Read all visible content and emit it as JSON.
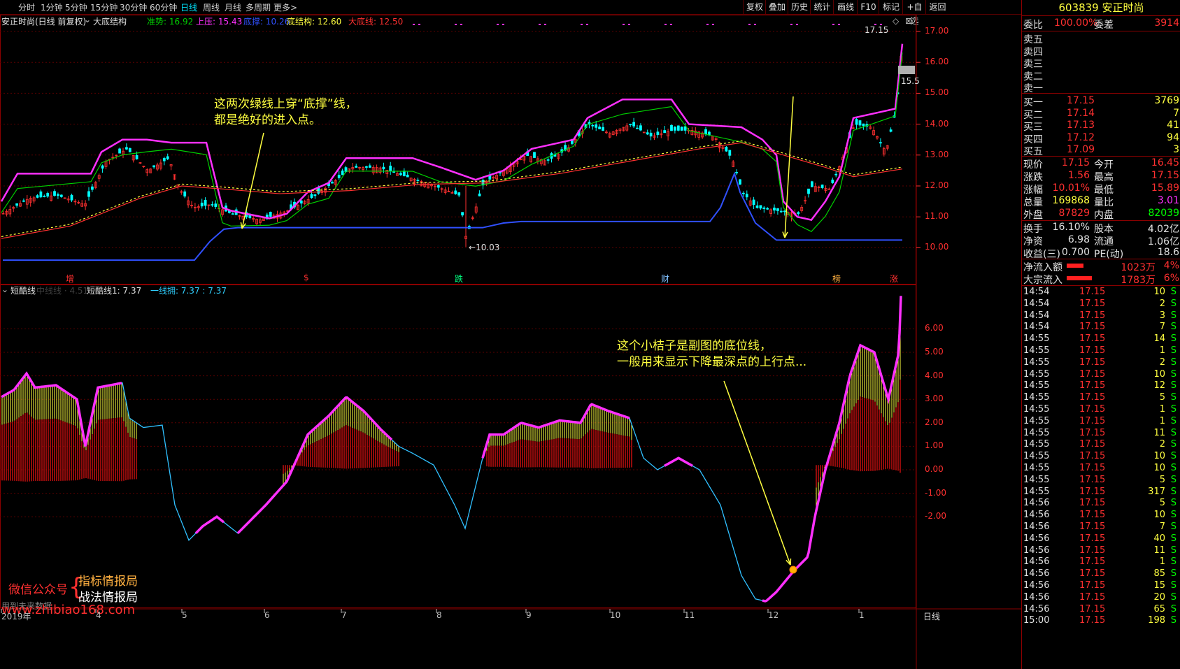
{
  "toolbar": {
    "periods": [
      "分时",
      "1分钟",
      "5分钟",
      "15分钟",
      "30分钟",
      "60分钟",
      "日线",
      "周线",
      "月线",
      "多周期",
      "更多>"
    ],
    "active_period": "日线",
    "buttons": [
      "复权",
      "叠加",
      "历史",
      "统计",
      "画线",
      "F10",
      "标记",
      "+自选",
      "返回"
    ]
  },
  "main_chart": {
    "title": "安正时尚(日线 前复权)",
    "indicator_name": "大底结构",
    "legend": [
      {
        "label": "准势: 16.92",
        "color": "#00d000"
      },
      {
        "label": "上压: 15.43",
        "color": "#ff30ff"
      },
      {
        "label": "底撑: 10.26",
        "color": "#3050ff"
      },
      {
        "label": "底结构: 12.60",
        "color": "#ffff40"
      },
      {
        "label": "大底线: 12.50",
        "color": "#ff3030"
      }
    ],
    "y_ticks": [
      "17.00",
      "16.00",
      "15.00",
      "14.00",
      "13.00",
      "12.00",
      "11.00",
      "10.00"
    ],
    "price_high_label": "17.15",
    "price_low_label": "10.03",
    "price_tag": "15.5",
    "markers": [
      {
        "text": "增",
        "color": "#ff3030"
      },
      {
        "text": "$",
        "color": "#ff3030"
      },
      {
        "text": "跌",
        "color": "#00ff80"
      },
      {
        "text": "财",
        "color": "#80c0ff"
      },
      {
        "text": "榜",
        "color": "#ffb040"
      },
      {
        "text": "涨",
        "color": "#ff3030"
      }
    ],
    "annotation": [
      "这两次绿线上穿“底撑”线，",
      "都是绝好的进入点。"
    ]
  },
  "sub_chart": {
    "title": "短酷线",
    "faded_label": "中线线 · 4.51",
    "legend1": "短酷线1: 7.37",
    "legend2": "一线拥: 7.37  : 7.37",
    "y_ticks": [
      "6.00",
      "5.00",
      "4.00",
      "3.00",
      "2.00",
      "1.00",
      "0.00",
      "-1.00",
      "-2.00"
    ],
    "annotation": [
      "这个小桔子是副图的底位线，",
      "一般用来显示下降最深点的上行点..."
    ]
  },
  "watermark": {
    "wechat_label": "微信公众号",
    "names": [
      "指标情报局",
      "战法情报局"
    ],
    "disclaimer": "用到未来数据",
    "url": "www.zhibiao168.com"
  },
  "x_axis": {
    "labels": [
      "2019年",
      "4",
      "5",
      "6",
      "7",
      "8",
      "9",
      "10",
      "11",
      "12",
      "1"
    ],
    "period_label": "日线"
  },
  "right_panel": {
    "stock_code": "603839",
    "stock_name": "安正时尚",
    "weibi_label": "委比",
    "weibi_value": "100.00%",
    "weicha_label": "委差",
    "weicha_value": "3914",
    "asks": [
      {
        "label": "卖五",
        "price": "",
        "vol": ""
      },
      {
        "label": "卖四",
        "price": "",
        "vol": ""
      },
      {
        "label": "卖三",
        "price": "",
        "vol": ""
      },
      {
        "label": "卖二",
        "price": "",
        "vol": ""
      },
      {
        "label": "卖一",
        "price": "",
        "vol": ""
      }
    ],
    "bids": [
      {
        "label": "买一",
        "price": "17.15",
        "vol": "3769"
      },
      {
        "label": "买二",
        "price": "17.14",
        "vol": "7"
      },
      {
        "label": "买三",
        "price": "17.13",
        "vol": "41"
      },
      {
        "label": "买四",
        "price": "17.12",
        "vol": "94"
      },
      {
        "label": "买五",
        "price": "17.09",
        "vol": "3"
      }
    ],
    "quote": [
      {
        "l1": "现价",
        "v1": "17.15",
        "l2": "今开",
        "v2": "16.45",
        "c1": "#ff3030",
        "c2": "#ff3030"
      },
      {
        "l1": "涨跌",
        "v1": "1.56",
        "l2": "最高",
        "v2": "17.15",
        "c1": "#ff3030",
        "c2": "#ff3030"
      },
      {
        "l1": "涨幅",
        "v1": "10.01%",
        "l2": "最低",
        "v2": "15.89",
        "c1": "#ff3030",
        "c2": "#ff3030"
      },
      {
        "l1": "总量",
        "v1": "169868",
        "l2": "量比",
        "v2": "3.01",
        "c1": "#ffff40",
        "c2": "#ff30ff"
      },
      {
        "l1": "外盘",
        "v1": "87829",
        "l2": "内盘",
        "v2": "82039",
        "c1": "#ff3030",
        "c2": "#00ff00"
      }
    ],
    "fundamentals": [
      {
        "l1": "换手",
        "v1": "16.10%",
        "l2": "股本",
        "v2": "4.02亿"
      },
      {
        "l1": "净资",
        "v1": "6.98",
        "l2": "流通",
        "v2": "1.06亿"
      },
      {
        "l1": "收益(三)",
        "v1": "0.700",
        "l2": "PE(动)",
        "v2": "18.6"
      }
    ],
    "flows": [
      {
        "label": "净流入额",
        "value": "1023万",
        "pct": "4%",
        "bar": 0.4
      },
      {
        "label": "大宗流入",
        "value": "1783万",
        "pct": "6%",
        "bar": 0.6
      }
    ],
    "ticks": [
      {
        "time": "14:54",
        "price": "17.15",
        "vol": "10",
        "side": "S"
      },
      {
        "time": "14:54",
        "price": "17.15",
        "vol": "2",
        "side": "S"
      },
      {
        "time": "14:54",
        "price": "17.15",
        "vol": "3",
        "side": "S"
      },
      {
        "time": "14:54",
        "price": "17.15",
        "vol": "7",
        "side": "S"
      },
      {
        "time": "14:55",
        "price": "17.15",
        "vol": "14",
        "side": "S"
      },
      {
        "time": "14:55",
        "price": "17.15",
        "vol": "1",
        "side": "S"
      },
      {
        "time": "14:55",
        "price": "17.15",
        "vol": "2",
        "side": "S"
      },
      {
        "time": "14:55",
        "price": "17.15",
        "vol": "10",
        "side": "S"
      },
      {
        "time": "14:55",
        "price": "17.15",
        "vol": "12",
        "side": "S"
      },
      {
        "time": "14:55",
        "price": "17.15",
        "vol": "5",
        "side": "S"
      },
      {
        "time": "14:55",
        "price": "17.15",
        "vol": "1",
        "side": "S"
      },
      {
        "time": "14:55",
        "price": "17.15",
        "vol": "1",
        "side": "S"
      },
      {
        "time": "14:55",
        "price": "17.15",
        "vol": "11",
        "side": "S"
      },
      {
        "time": "14:55",
        "price": "17.15",
        "vol": "2",
        "side": "S"
      },
      {
        "time": "14:55",
        "price": "17.15",
        "vol": "10",
        "side": "S"
      },
      {
        "time": "14:55",
        "price": "17.15",
        "vol": "10",
        "side": "S"
      },
      {
        "time": "14:55",
        "price": "17.15",
        "vol": "5",
        "side": "S"
      },
      {
        "time": "14:55",
        "price": "17.15",
        "vol": "317",
        "side": "S"
      },
      {
        "time": "14:56",
        "price": "17.15",
        "vol": "5",
        "side": "S"
      },
      {
        "time": "14:56",
        "price": "17.15",
        "vol": "10",
        "side": "S"
      },
      {
        "time": "14:56",
        "price": "17.15",
        "vol": "7",
        "side": "S"
      },
      {
        "time": "14:56",
        "price": "17.15",
        "vol": "40",
        "side": "S"
      },
      {
        "time": "14:56",
        "price": "17.15",
        "vol": "11",
        "side": "S"
      },
      {
        "time": "14:56",
        "price": "17.15",
        "vol": "1",
        "side": "S"
      },
      {
        "time": "14:56",
        "price": "17.15",
        "vol": "85",
        "side": "S"
      },
      {
        "time": "14:56",
        "price": "17.15",
        "vol": "15",
        "side": "S"
      },
      {
        "time": "14:56",
        "price": "17.15",
        "vol": "20",
        "side": "S"
      },
      {
        "time": "14:56",
        "price": "17.15",
        "vol": "65",
        "side": "S"
      },
      {
        "time": "15:00",
        "price": "17.15",
        "vol": "198",
        "side": "S"
      }
    ]
  },
  "colors": {
    "up": "#ff3030",
    "down": "#00ffff",
    "grid": "#5a0000",
    "support": "#3050ff",
    "pressure": "#ff30ff",
    "trend": "#00d000",
    "bottom_structure": "#ffff40",
    "bottom_line": "#ff3030"
  }
}
